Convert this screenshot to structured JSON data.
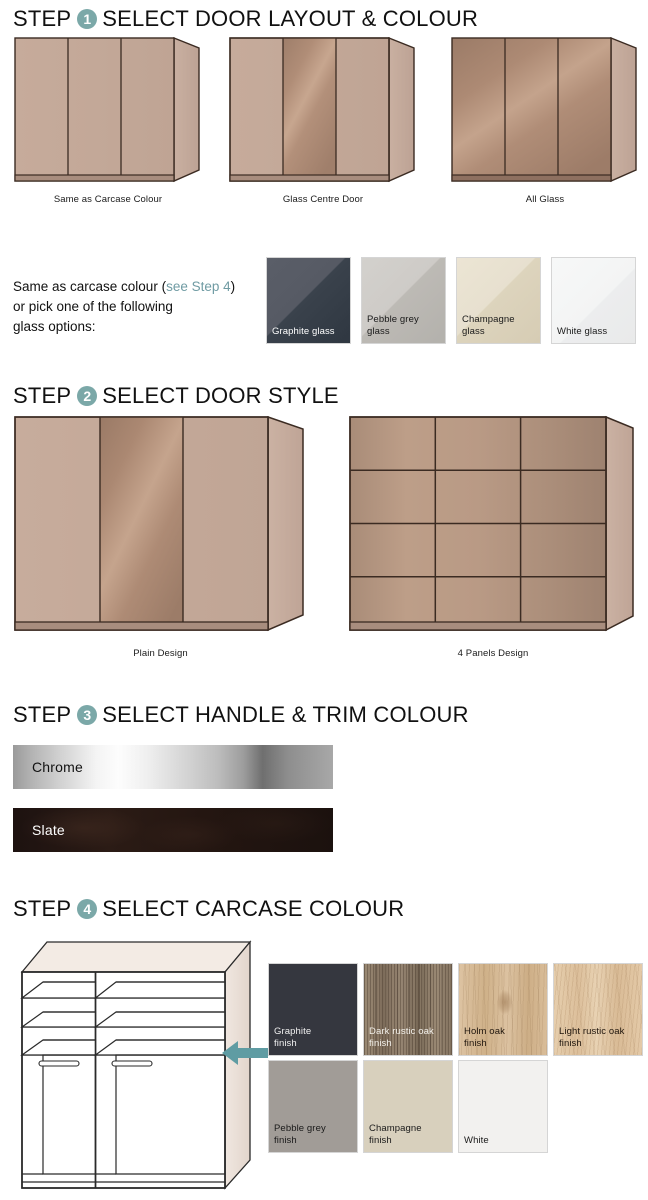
{
  "theme": {
    "badge_color": "#7ba8a8",
    "link_color": "#6f9ba3",
    "arrow_color": "#5f9ca3",
    "heading_color": "#111111",
    "door_fill": "#c3a898",
    "door_side_fill": "#bda294",
    "door_outline": "#3b2b22"
  },
  "steps": [
    {
      "word": "STEP",
      "number": "1",
      "title": "SELECT DOOR LAYOUT & COLOUR"
    },
    {
      "word": "STEP",
      "number": "2",
      "title": "SELECT DOOR STYLE"
    },
    {
      "word": "STEP",
      "number": "3",
      "title": "SELECT HANDLE & TRIM COLOUR"
    },
    {
      "word": "STEP",
      "number": "4",
      "title": "SELECT CARCASE COLOUR"
    }
  ],
  "step1": {
    "layouts": [
      {
        "caption": "Same as Carcase Colour",
        "glass_doors": []
      },
      {
        "caption": "Glass Centre Door",
        "glass_doors": [
          1
        ]
      },
      {
        "caption": "All Glass",
        "glass_doors": [
          0,
          1,
          2
        ]
      }
    ],
    "intro_line1_before": "Same as carcase colour (",
    "intro_link": "see Step 4",
    "intro_line1_after": ")",
    "intro_line2": "or pick one of the following",
    "intro_line3": "glass options:",
    "glass_swatches": [
      {
        "label": "Graphite glass",
        "color": "#4c505a",
        "shade": "#2f3741",
        "text_color": "#ffffff"
      },
      {
        "label": "Pebble grey\nglass",
        "color": "#c6c4c0",
        "shade": "#b3b1ac",
        "text_color": "#1a1a1a"
      },
      {
        "label": "Champagne\nglass",
        "color": "#e4dcc8",
        "shade": "#d6ccb4",
        "text_color": "#1a1a1a"
      },
      {
        "label": "White glass",
        "color": "#f2f3f3",
        "shade": "#e9eaea",
        "text_color": "#1a1a1a"
      }
    ]
  },
  "step2": {
    "styles": [
      {
        "caption": "Plain Design",
        "panel_rows": 1
      },
      {
        "caption": "4 Panels Design",
        "panel_rows": 4
      }
    ]
  },
  "step3": {
    "bars": [
      {
        "label": "Chrome",
        "text_color": "#111111"
      },
      {
        "label": "Slate",
        "text_color": "#ffffff"
      }
    ]
  },
  "step4": {
    "finishes": [
      {
        "label": "Graphite\nfinish",
        "color": "#35373f",
        "text_color": "#f0f0f0",
        "texture": "solid"
      },
      {
        "label": "Dark rustic oak\nfinish",
        "color": "#8d7c68",
        "text_color": "#f2efe9",
        "texture": "wood-dark"
      },
      {
        "label": "Holm oak\nfinish",
        "color": "#d6b793",
        "text_color": "#20160d",
        "texture": "wood-mid"
      },
      {
        "label": "Light rustic oak\nfinish",
        "color": "#e0c4a1",
        "text_color": "#20160d",
        "texture": "wood-light"
      },
      {
        "label": "Pebble grey\nfinish",
        "color": "#a19c97",
        "text_color": "#1a1a1a",
        "texture": "solid"
      },
      {
        "label": "Champagne\nfinish",
        "color": "#d8d0bd",
        "text_color": "#1a1a1a",
        "texture": "solid"
      },
      {
        "label": "White",
        "color": "#f2f1ef",
        "text_color": "#1a1a1a",
        "texture": "solid"
      }
    ]
  }
}
